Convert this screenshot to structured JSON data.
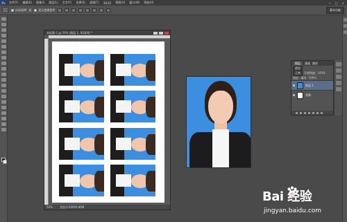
{
  "menubar": {
    "logo": "Ps",
    "items": [
      "文件(F)",
      "编辑(E)",
      "图像(I)",
      "图层(L)",
      "文字(Y)",
      "选择(S)",
      "滤镜(T)",
      "3D(D)",
      "视图(V)",
      "窗口(W)",
      "帮助(H)"
    ],
    "window_buttons": [
      "—",
      "□",
      "×"
    ]
  },
  "optionsbar": {
    "auto_select_label": "自动选择:",
    "auto_select_value": "组",
    "transform_label": "显示变换控件",
    "workspace": "基本功能"
  },
  "document": {
    "tab_title": "未标题-1 @ 50% (图层 1, RGB/8) *",
    "zoom": "50%",
    "doc_info": "文档:4.92M/9.88M"
  },
  "layers_panel": {
    "tabs": [
      "图层",
      "通道",
      "路径"
    ],
    "kind_label": "类型",
    "blend_mode": "正常",
    "opacity_label": "不透明度:",
    "opacity_value": "100%",
    "lock_label": "锁定:",
    "fill_label": "填充:",
    "fill_value": "100%",
    "layers": [
      {
        "name": "图层 1",
        "active": true
      },
      {
        "name": "背景",
        "active": false
      }
    ]
  },
  "watermark": {
    "brand": "Bai  经验",
    "url": "jingyan.baidu.com"
  },
  "colors": {
    "photo_background": "#3b8ee0",
    "app_background": "#4a4a4a"
  }
}
